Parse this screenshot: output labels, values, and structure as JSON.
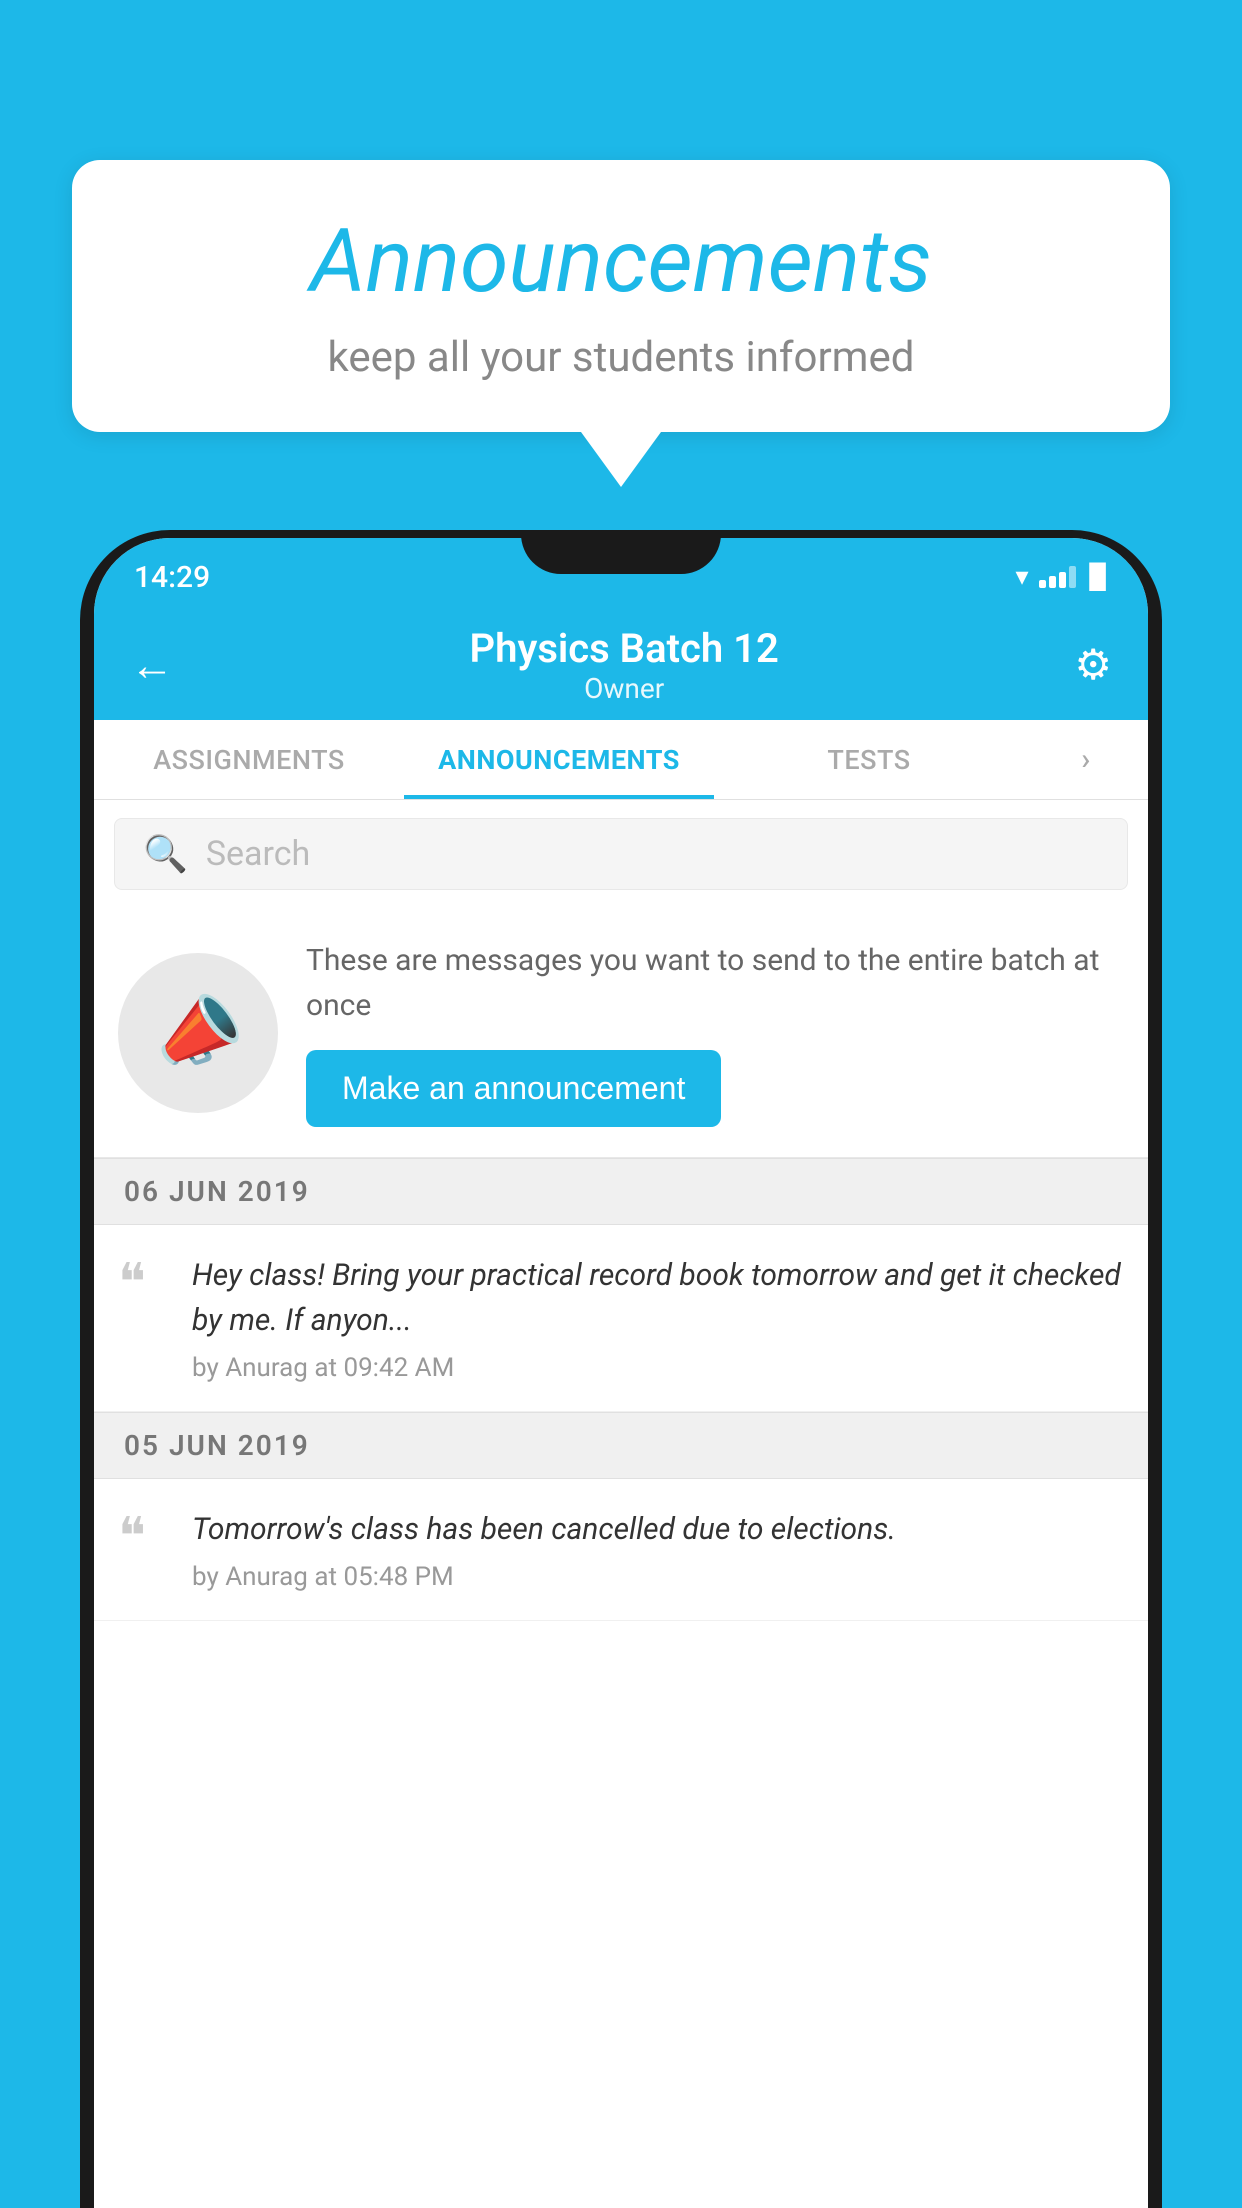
{
  "background": {
    "color": "#1DB8E8"
  },
  "speech_bubble": {
    "title": "Announcements",
    "subtitle": "keep all your students informed"
  },
  "status_bar": {
    "time": "14:29"
  },
  "header": {
    "title": "Physics Batch 12",
    "subtitle": "Owner",
    "back_label": "←",
    "gear_label": "⚙"
  },
  "tabs": [
    {
      "label": "ASSIGNMENTS",
      "active": false
    },
    {
      "label": "ANNOUNCEMENTS",
      "active": true
    },
    {
      "label": "TESTS",
      "active": false
    },
    {
      "label": "•••",
      "active": false
    }
  ],
  "search": {
    "placeholder": "Search"
  },
  "promo": {
    "description": "These are messages you want to send to the entire batch at once",
    "button_label": "Make an announcement"
  },
  "announcements": [
    {
      "date": "06  JUN  2019",
      "text": "Hey class! Bring your practical record book tomorrow and get it checked by me. If anyon...",
      "meta": "by Anurag at 09:42 AM"
    },
    {
      "date": "05  JUN  2019",
      "text": "Tomorrow's class has been cancelled due to elections.",
      "meta": "by Anurag at 05:48 PM"
    }
  ]
}
